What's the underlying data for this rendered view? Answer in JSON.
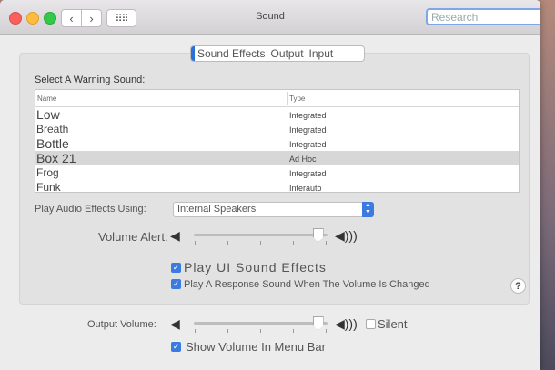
{
  "window": {
    "title": "Sound"
  },
  "toolbar": {
    "back_icon": "chevron-left-icon",
    "forward_icon": "chevron-right-icon",
    "grid_icon": "grid-icon",
    "back_glyph": "‹",
    "forward_glyph": "›",
    "grid_glyph": "⠿⠿"
  },
  "search": {
    "placeholder": "Research"
  },
  "tabs": [
    {
      "label": "Sound Effects",
      "selected": true
    },
    {
      "label": "Output",
      "selected": false
    },
    {
      "label": "Input",
      "selected": false
    }
  ],
  "effects": {
    "select_label": "Select A Warning Sound:",
    "columns": [
      "Name",
      "Type"
    ],
    "rows": [
      {
        "name": "Low",
        "type": "Integrated"
      },
      {
        "name": "Breath",
        "type": "Integrated"
      },
      {
        "name": "Bottle",
        "type": "Integrated"
      },
      {
        "name": "Box 21",
        "type": "Ad Hoc",
        "highlighted": true
      },
      {
        "name": "Frog",
        "type": "Integrated"
      },
      {
        "name": "Funk",
        "type": "Interauto"
      }
    ],
    "play_through_label": "Play Audio Effects Using:",
    "play_through_value": "Internal Speakers",
    "volume_alert_label": "Volume Alert:",
    "volume_alert_level": 0.93,
    "ui_sounds_label": "Play UI Sound Effects",
    "ui_sounds_checked": true,
    "feedback_label": "Play A Response Sound When The Volume Is Changed",
    "feedback_checked": true,
    "help_glyph": "?"
  },
  "output": {
    "volume_label": "Output Volume:",
    "volume_level": 0.93,
    "silent_label": "Silent",
    "silent_checked": false,
    "menu_bar_label": "Show Volume In Menu Bar",
    "menu_bar_checked": true
  },
  "colors": {
    "accent": "#3b7ae0",
    "close": "#fc605c",
    "minimize": "#fdbc40",
    "zoom": "#34c84a"
  }
}
